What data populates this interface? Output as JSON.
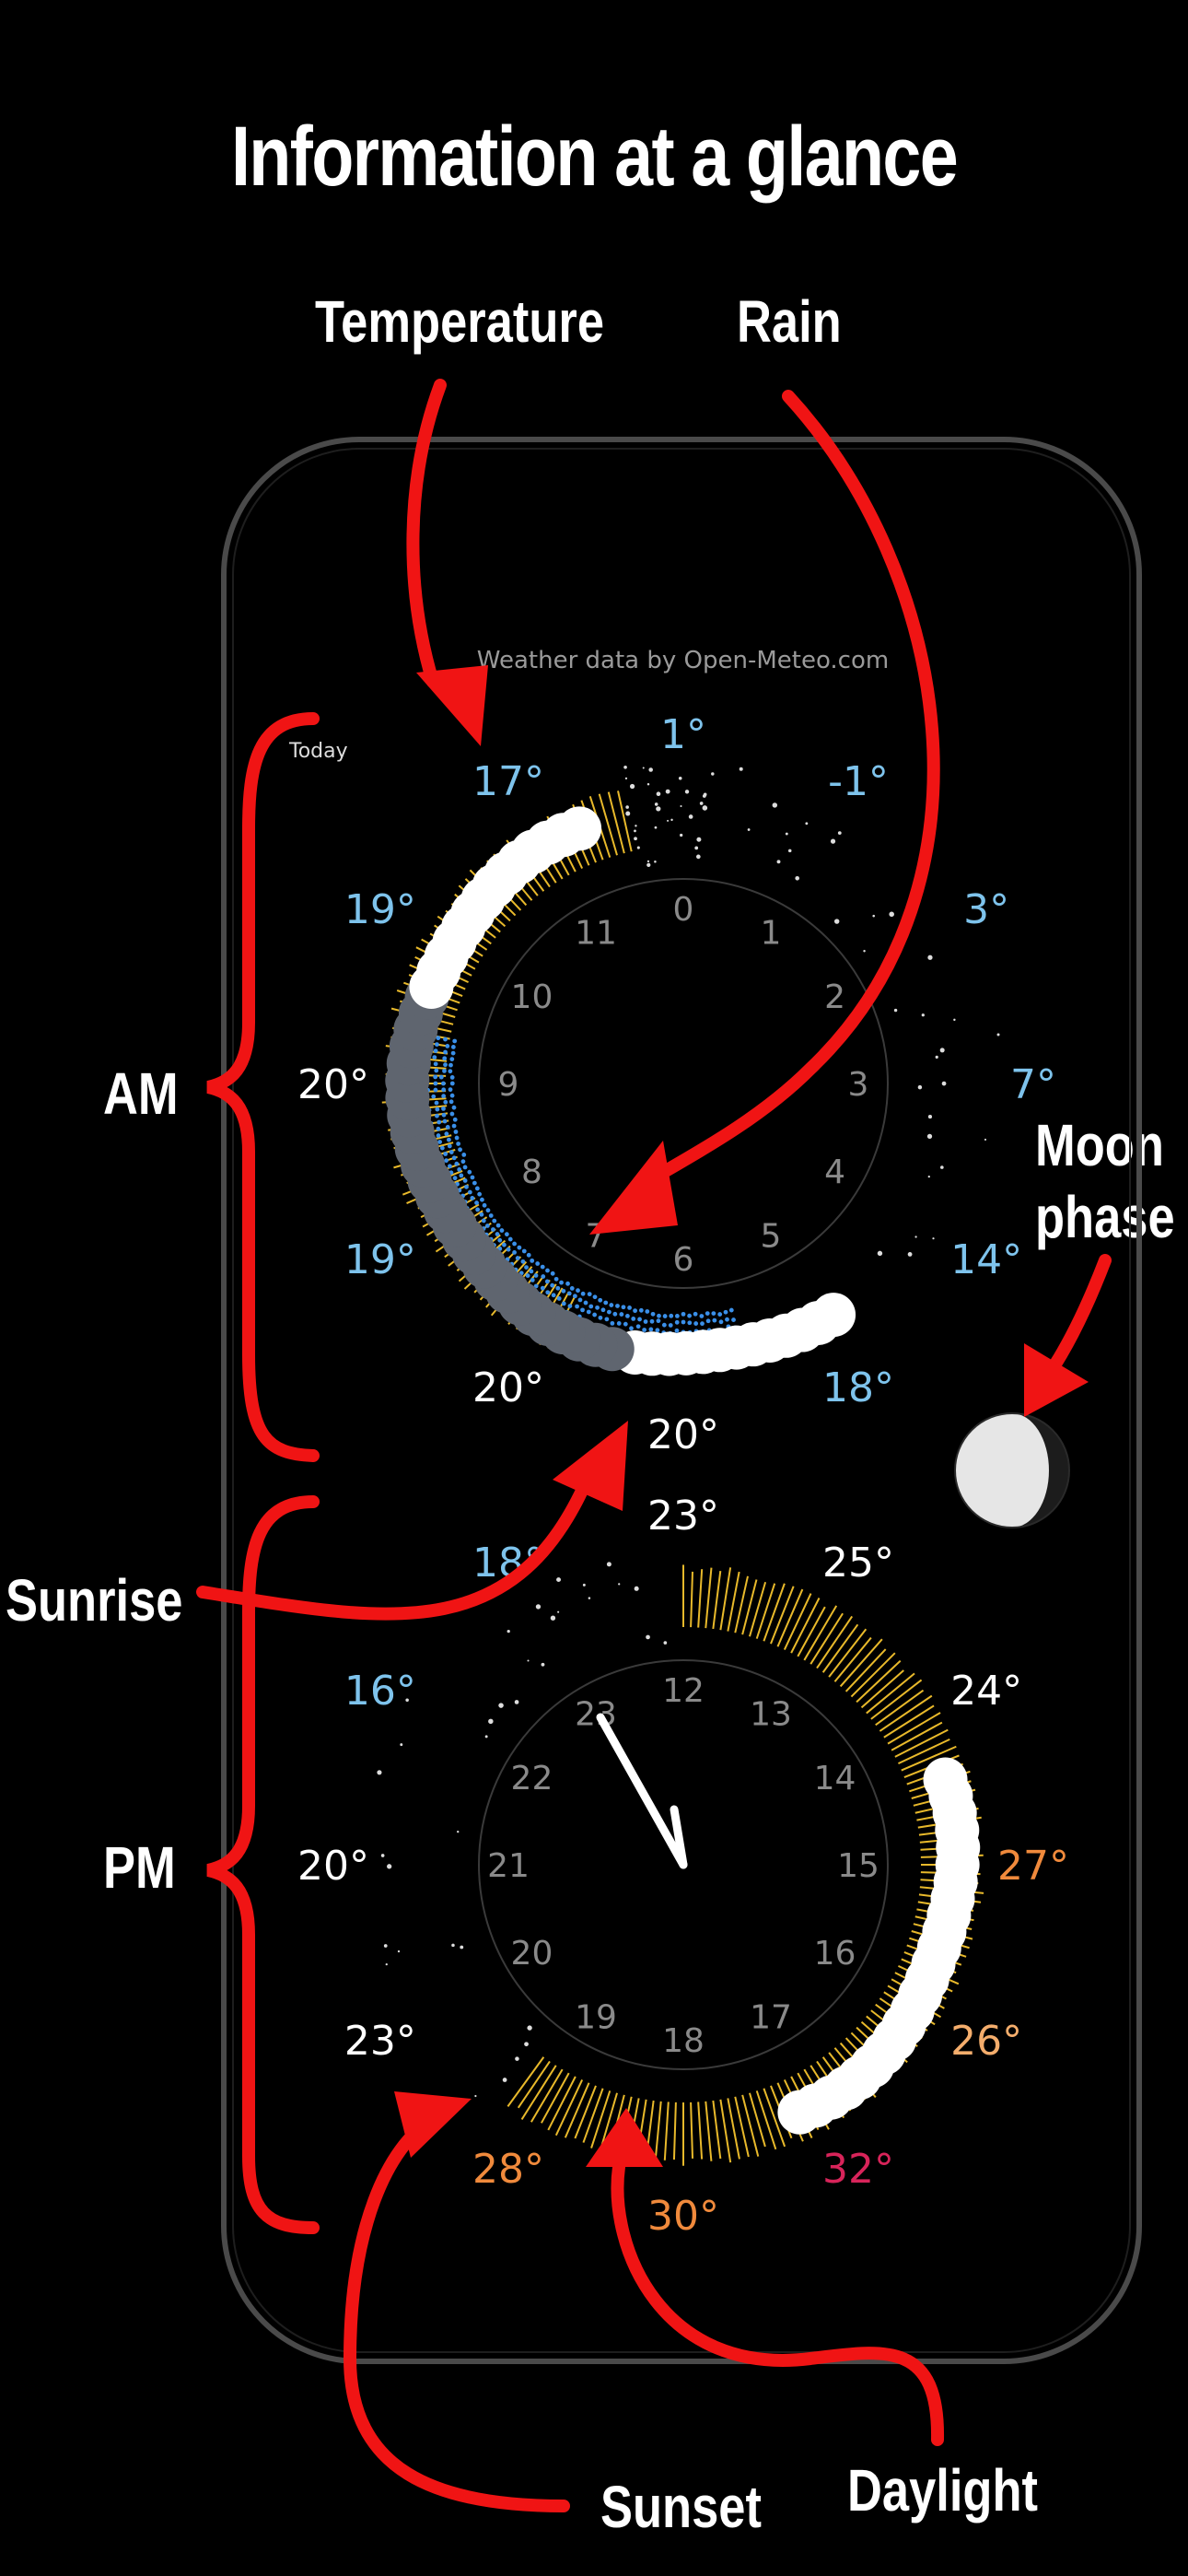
{
  "headline": "Information at a glance",
  "callouts": {
    "temperature": "Temperature",
    "rain": "Rain",
    "am": "AM",
    "pm": "PM",
    "moon_phase_line1": "Moon",
    "moon_phase_line2": "phase",
    "sunrise": "Sunrise",
    "sunset": "Sunset",
    "daylight": "Daylight"
  },
  "app": {
    "attribution": "Weather data by Open-Meteo.com",
    "day_label": "Today"
  },
  "colors": {
    "cold": "#7ec3ec",
    "neutral": "#ffffff",
    "warm": "#f4ad6c",
    "hot": "#f08a3c",
    "very_hot": "#d8245a",
    "daylight": "#e8b92b",
    "rain": "#3a8fe8",
    "cloud": "#5f656f",
    "arrow": "#f01414"
  },
  "am_dial": {
    "hour_labels": [
      "0",
      "1",
      "2",
      "3",
      "4",
      "5",
      "6",
      "7",
      "8",
      "9",
      "10",
      "11"
    ],
    "temperatures": [
      {
        "hour": 0,
        "text": "1°",
        "tone": "cold"
      },
      {
        "hour": 1,
        "text": "-1°",
        "tone": "cold"
      },
      {
        "hour": 2,
        "text": "3°",
        "tone": "cold"
      },
      {
        "hour": 3,
        "text": "7°",
        "tone": "cold"
      },
      {
        "hour": 4,
        "text": "14°",
        "tone": "cold"
      },
      {
        "hour": 5,
        "text": "18°",
        "tone": "cold"
      },
      {
        "hour": 6,
        "text": "20°",
        "tone": "neutral"
      },
      {
        "hour": 7,
        "text": "20°",
        "tone": "neutral"
      },
      {
        "hour": 8,
        "text": "19°",
        "tone": "cold"
      },
      {
        "hour": 9,
        "text": "20°",
        "tone": "neutral"
      },
      {
        "hour": 10,
        "text": "19°",
        "tone": "cold"
      },
      {
        "hour": 11,
        "text": "17°",
        "tone": "cold"
      }
    ]
  },
  "pm_dial": {
    "hour_labels": [
      "12",
      "13",
      "14",
      "15",
      "16",
      "17",
      "18",
      "19",
      "20",
      "21",
      "22",
      "23"
    ],
    "temperatures": [
      {
        "hour": 12,
        "text": "23°",
        "tone": "neutral"
      },
      {
        "hour": 13,
        "text": "25°",
        "tone": "neutral"
      },
      {
        "hour": 14,
        "text": "24°",
        "tone": "neutral"
      },
      {
        "hour": 15,
        "text": "27°",
        "tone": "hot"
      },
      {
        "hour": 16,
        "text": "26°",
        "tone": "warm"
      },
      {
        "hour": 17,
        "text": "32°",
        "tone": "very_hot"
      },
      {
        "hour": 18,
        "text": "30°",
        "tone": "hot"
      },
      {
        "hour": 19,
        "text": "28°",
        "tone": "hot"
      },
      {
        "hour": 20,
        "text": "23°",
        "tone": "neutral"
      },
      {
        "hour": 21,
        "text": "20°",
        "tone": "neutral"
      },
      {
        "hour": 22,
        "text": "16°",
        "tone": "cold"
      },
      {
        "hour": 23,
        "text": "18°",
        "tone": "cold"
      }
    ],
    "current_time": "11:00"
  }
}
